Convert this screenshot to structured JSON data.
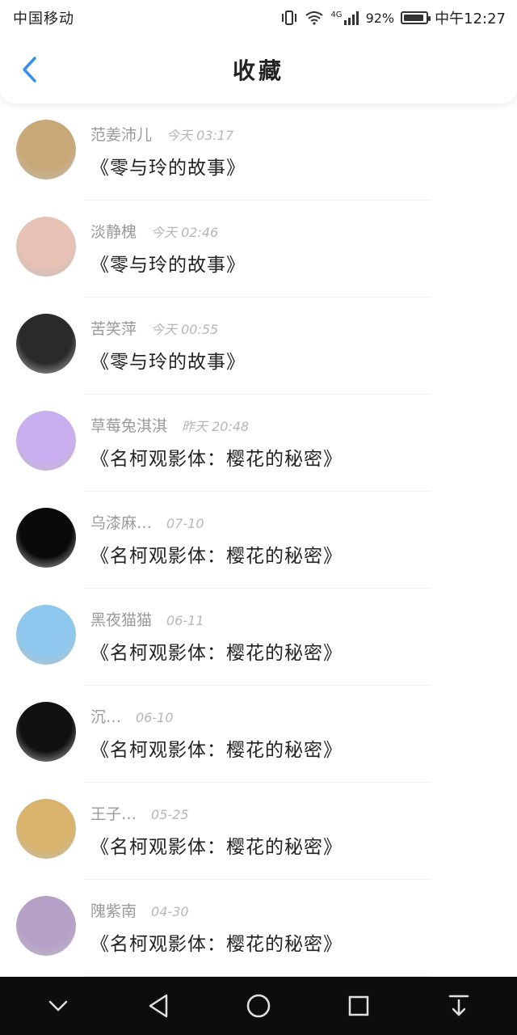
{
  "status_bar": {
    "carrier": "中国移动",
    "network": "4G",
    "battery": "92%",
    "battery_level": 0.92,
    "time": "中午12:27"
  },
  "header": {
    "title": "收藏",
    "back_icon": "back-chevron-icon",
    "accent_color": "#3a8fe8"
  },
  "favorites": [
    {
      "name": "范姜沛儿",
      "time": "今天 03:17",
      "title": "《零与玲的故事》",
      "avatar_color": "#c9a877"
    },
    {
      "name": "淡静槐",
      "time": "今天 02:46",
      "title": "《零与玲的故事》",
      "avatar_color": "#e8c2b4"
    },
    {
      "name": "苦笑萍",
      "time": "今天 00:55",
      "title": "《零与玲的故事》",
      "avatar_color": "#2a2a2a"
    },
    {
      "name": "草莓兔淇淇",
      "time": "昨天 20:48",
      "title": "《名柯观影体：樱花的秘密》",
      "avatar_color": "#c9aef0"
    },
    {
      "name": "乌漆麻…",
      "time": "07-10",
      "title": "《名柯观影体：樱花的秘密》",
      "avatar_color": "#0a0a0a"
    },
    {
      "name": "黑夜猫猫",
      "time": "06-11",
      "title": "《名柯观影体：樱花的秘密》",
      "avatar_color": "#8fc8ee"
    },
    {
      "name": "沉…",
      "time": "06-10",
      "title": "《名柯观影体：樱花的秘密》",
      "avatar_color": "#111111"
    },
    {
      "name": "王子…",
      "time": "05-25",
      "title": "《名柯观影体：樱花的秘密》",
      "avatar_color": "#d9b36b"
    },
    {
      "name": "隗紫南",
      "time": "04-30",
      "title": "《名柯观影体：樱花的秘密》",
      "avatar_color": "#b6a0c8"
    }
  ],
  "nav_bar": {
    "buttons": [
      "collapse-chevron-icon",
      "back-triangle-icon",
      "home-circle-icon",
      "recents-square-icon",
      "notification-pull-icon"
    ]
  }
}
